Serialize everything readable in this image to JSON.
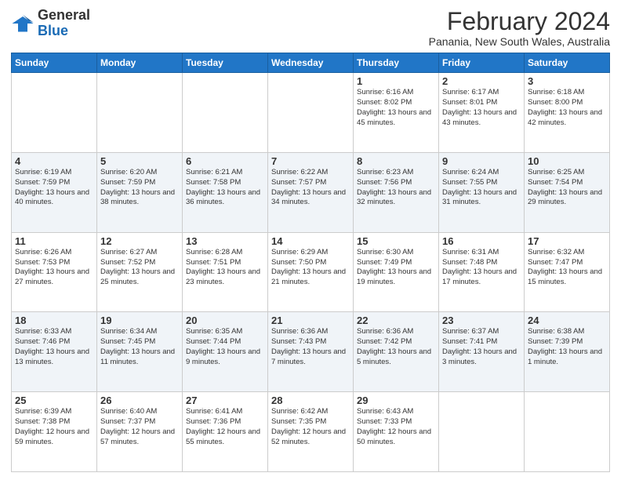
{
  "header": {
    "logo_general": "General",
    "logo_blue": "Blue",
    "month_title": "February 2024",
    "subtitle": "Panania, New South Wales, Australia"
  },
  "days_of_week": [
    "Sunday",
    "Monday",
    "Tuesday",
    "Wednesday",
    "Thursday",
    "Friday",
    "Saturday"
  ],
  "weeks": [
    [
      {
        "day": "",
        "info": ""
      },
      {
        "day": "",
        "info": ""
      },
      {
        "day": "",
        "info": ""
      },
      {
        "day": "",
        "info": ""
      },
      {
        "day": "1",
        "info": "Sunrise: 6:16 AM\nSunset: 8:02 PM\nDaylight: 13 hours\nand 45 minutes."
      },
      {
        "day": "2",
        "info": "Sunrise: 6:17 AM\nSunset: 8:01 PM\nDaylight: 13 hours\nand 43 minutes."
      },
      {
        "day": "3",
        "info": "Sunrise: 6:18 AM\nSunset: 8:00 PM\nDaylight: 13 hours\nand 42 minutes."
      }
    ],
    [
      {
        "day": "4",
        "info": "Sunrise: 6:19 AM\nSunset: 7:59 PM\nDaylight: 13 hours\nand 40 minutes."
      },
      {
        "day": "5",
        "info": "Sunrise: 6:20 AM\nSunset: 7:59 PM\nDaylight: 13 hours\nand 38 minutes."
      },
      {
        "day": "6",
        "info": "Sunrise: 6:21 AM\nSunset: 7:58 PM\nDaylight: 13 hours\nand 36 minutes."
      },
      {
        "day": "7",
        "info": "Sunrise: 6:22 AM\nSunset: 7:57 PM\nDaylight: 13 hours\nand 34 minutes."
      },
      {
        "day": "8",
        "info": "Sunrise: 6:23 AM\nSunset: 7:56 PM\nDaylight: 13 hours\nand 32 minutes."
      },
      {
        "day": "9",
        "info": "Sunrise: 6:24 AM\nSunset: 7:55 PM\nDaylight: 13 hours\nand 31 minutes."
      },
      {
        "day": "10",
        "info": "Sunrise: 6:25 AM\nSunset: 7:54 PM\nDaylight: 13 hours\nand 29 minutes."
      }
    ],
    [
      {
        "day": "11",
        "info": "Sunrise: 6:26 AM\nSunset: 7:53 PM\nDaylight: 13 hours\nand 27 minutes."
      },
      {
        "day": "12",
        "info": "Sunrise: 6:27 AM\nSunset: 7:52 PM\nDaylight: 13 hours\nand 25 minutes."
      },
      {
        "day": "13",
        "info": "Sunrise: 6:28 AM\nSunset: 7:51 PM\nDaylight: 13 hours\nand 23 minutes."
      },
      {
        "day": "14",
        "info": "Sunrise: 6:29 AM\nSunset: 7:50 PM\nDaylight: 13 hours\nand 21 minutes."
      },
      {
        "day": "15",
        "info": "Sunrise: 6:30 AM\nSunset: 7:49 PM\nDaylight: 13 hours\nand 19 minutes."
      },
      {
        "day": "16",
        "info": "Sunrise: 6:31 AM\nSunset: 7:48 PM\nDaylight: 13 hours\nand 17 minutes."
      },
      {
        "day": "17",
        "info": "Sunrise: 6:32 AM\nSunset: 7:47 PM\nDaylight: 13 hours\nand 15 minutes."
      }
    ],
    [
      {
        "day": "18",
        "info": "Sunrise: 6:33 AM\nSunset: 7:46 PM\nDaylight: 13 hours\nand 13 minutes."
      },
      {
        "day": "19",
        "info": "Sunrise: 6:34 AM\nSunset: 7:45 PM\nDaylight: 13 hours\nand 11 minutes."
      },
      {
        "day": "20",
        "info": "Sunrise: 6:35 AM\nSunset: 7:44 PM\nDaylight: 13 hours\nand 9 minutes."
      },
      {
        "day": "21",
        "info": "Sunrise: 6:36 AM\nSunset: 7:43 PM\nDaylight: 13 hours\nand 7 minutes."
      },
      {
        "day": "22",
        "info": "Sunrise: 6:36 AM\nSunset: 7:42 PM\nDaylight: 13 hours\nand 5 minutes."
      },
      {
        "day": "23",
        "info": "Sunrise: 6:37 AM\nSunset: 7:41 PM\nDaylight: 13 hours\nand 3 minutes."
      },
      {
        "day": "24",
        "info": "Sunrise: 6:38 AM\nSunset: 7:39 PM\nDaylight: 13 hours\nand 1 minute."
      }
    ],
    [
      {
        "day": "25",
        "info": "Sunrise: 6:39 AM\nSunset: 7:38 PM\nDaylight: 12 hours\nand 59 minutes."
      },
      {
        "day": "26",
        "info": "Sunrise: 6:40 AM\nSunset: 7:37 PM\nDaylight: 12 hours\nand 57 minutes."
      },
      {
        "day": "27",
        "info": "Sunrise: 6:41 AM\nSunset: 7:36 PM\nDaylight: 12 hours\nand 55 minutes."
      },
      {
        "day": "28",
        "info": "Sunrise: 6:42 AM\nSunset: 7:35 PM\nDaylight: 12 hours\nand 52 minutes."
      },
      {
        "day": "29",
        "info": "Sunrise: 6:43 AM\nSunset: 7:33 PM\nDaylight: 12 hours\nand 50 minutes."
      },
      {
        "day": "",
        "info": ""
      },
      {
        "day": "",
        "info": ""
      }
    ]
  ]
}
